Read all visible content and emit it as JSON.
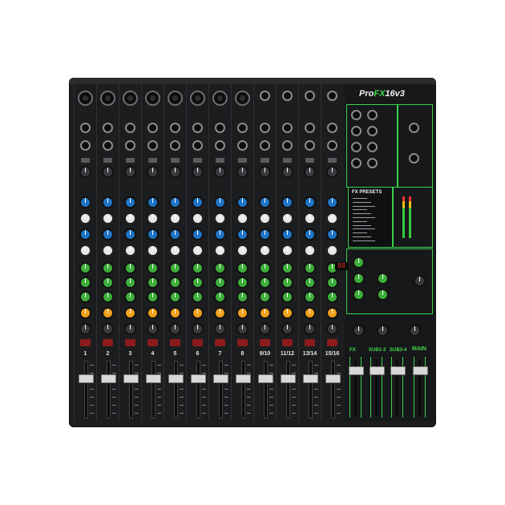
{
  "product": {
    "brand_model": "ProFX16v3",
    "brand_prefix": "Pro",
    "brand_highlight": "FX",
    "brand_suffix": "16v3"
  },
  "channels": {
    "labels": [
      "1",
      "2",
      "3",
      "4",
      "5",
      "6",
      "7",
      "8",
      "9/10",
      "11/12",
      "13/14",
      "15/16"
    ]
  },
  "master": {
    "fx_label": "FX",
    "sub12_label": "SUB1-2",
    "sub34_label": "SUB3-4",
    "main_label": "MAIN",
    "fx_presets_label": "FX PRESETS",
    "display_value": "88"
  }
}
